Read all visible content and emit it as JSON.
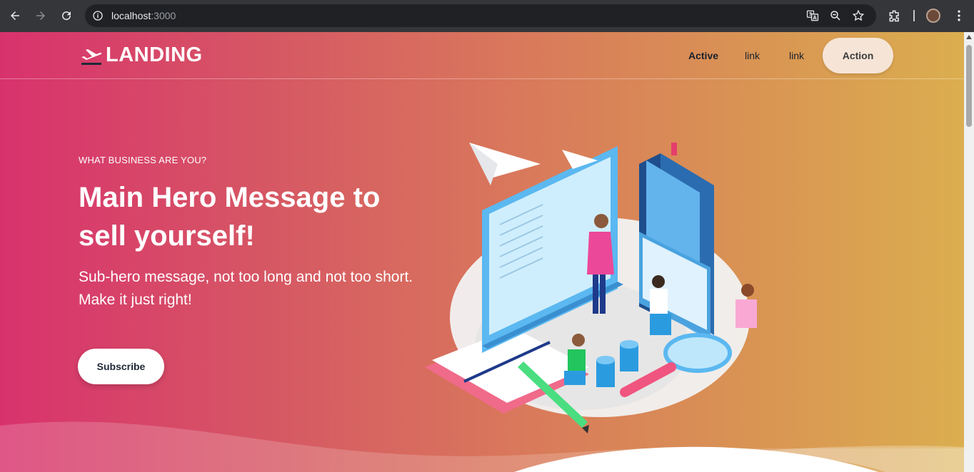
{
  "browser": {
    "url_host": "localhost",
    "url_port": ":3000"
  },
  "header": {
    "brand": "LANDING",
    "nav": [
      "Active",
      "link",
      "link"
    ],
    "action_label": "Action"
  },
  "hero": {
    "eyebrow": "WHAT BUSINESS ARE YOU?",
    "title": "Main Hero Message to sell yourself!",
    "subtitle": "Sub-hero message, not too long and not too short. Make it just right!",
    "cta_label": "Subscribe"
  },
  "colors": {
    "gradient_start": "#d8326d",
    "gradient_end": "#dbae4f",
    "action_bg": "#f6e5d7"
  },
  "icons": [
    "back-icon",
    "forward-icon",
    "reload-icon",
    "info-icon",
    "translate-icon",
    "zoom-icon",
    "bookmark-star-icon",
    "extensions-icon",
    "menu-dots-icon",
    "plane-logo-icon"
  ]
}
